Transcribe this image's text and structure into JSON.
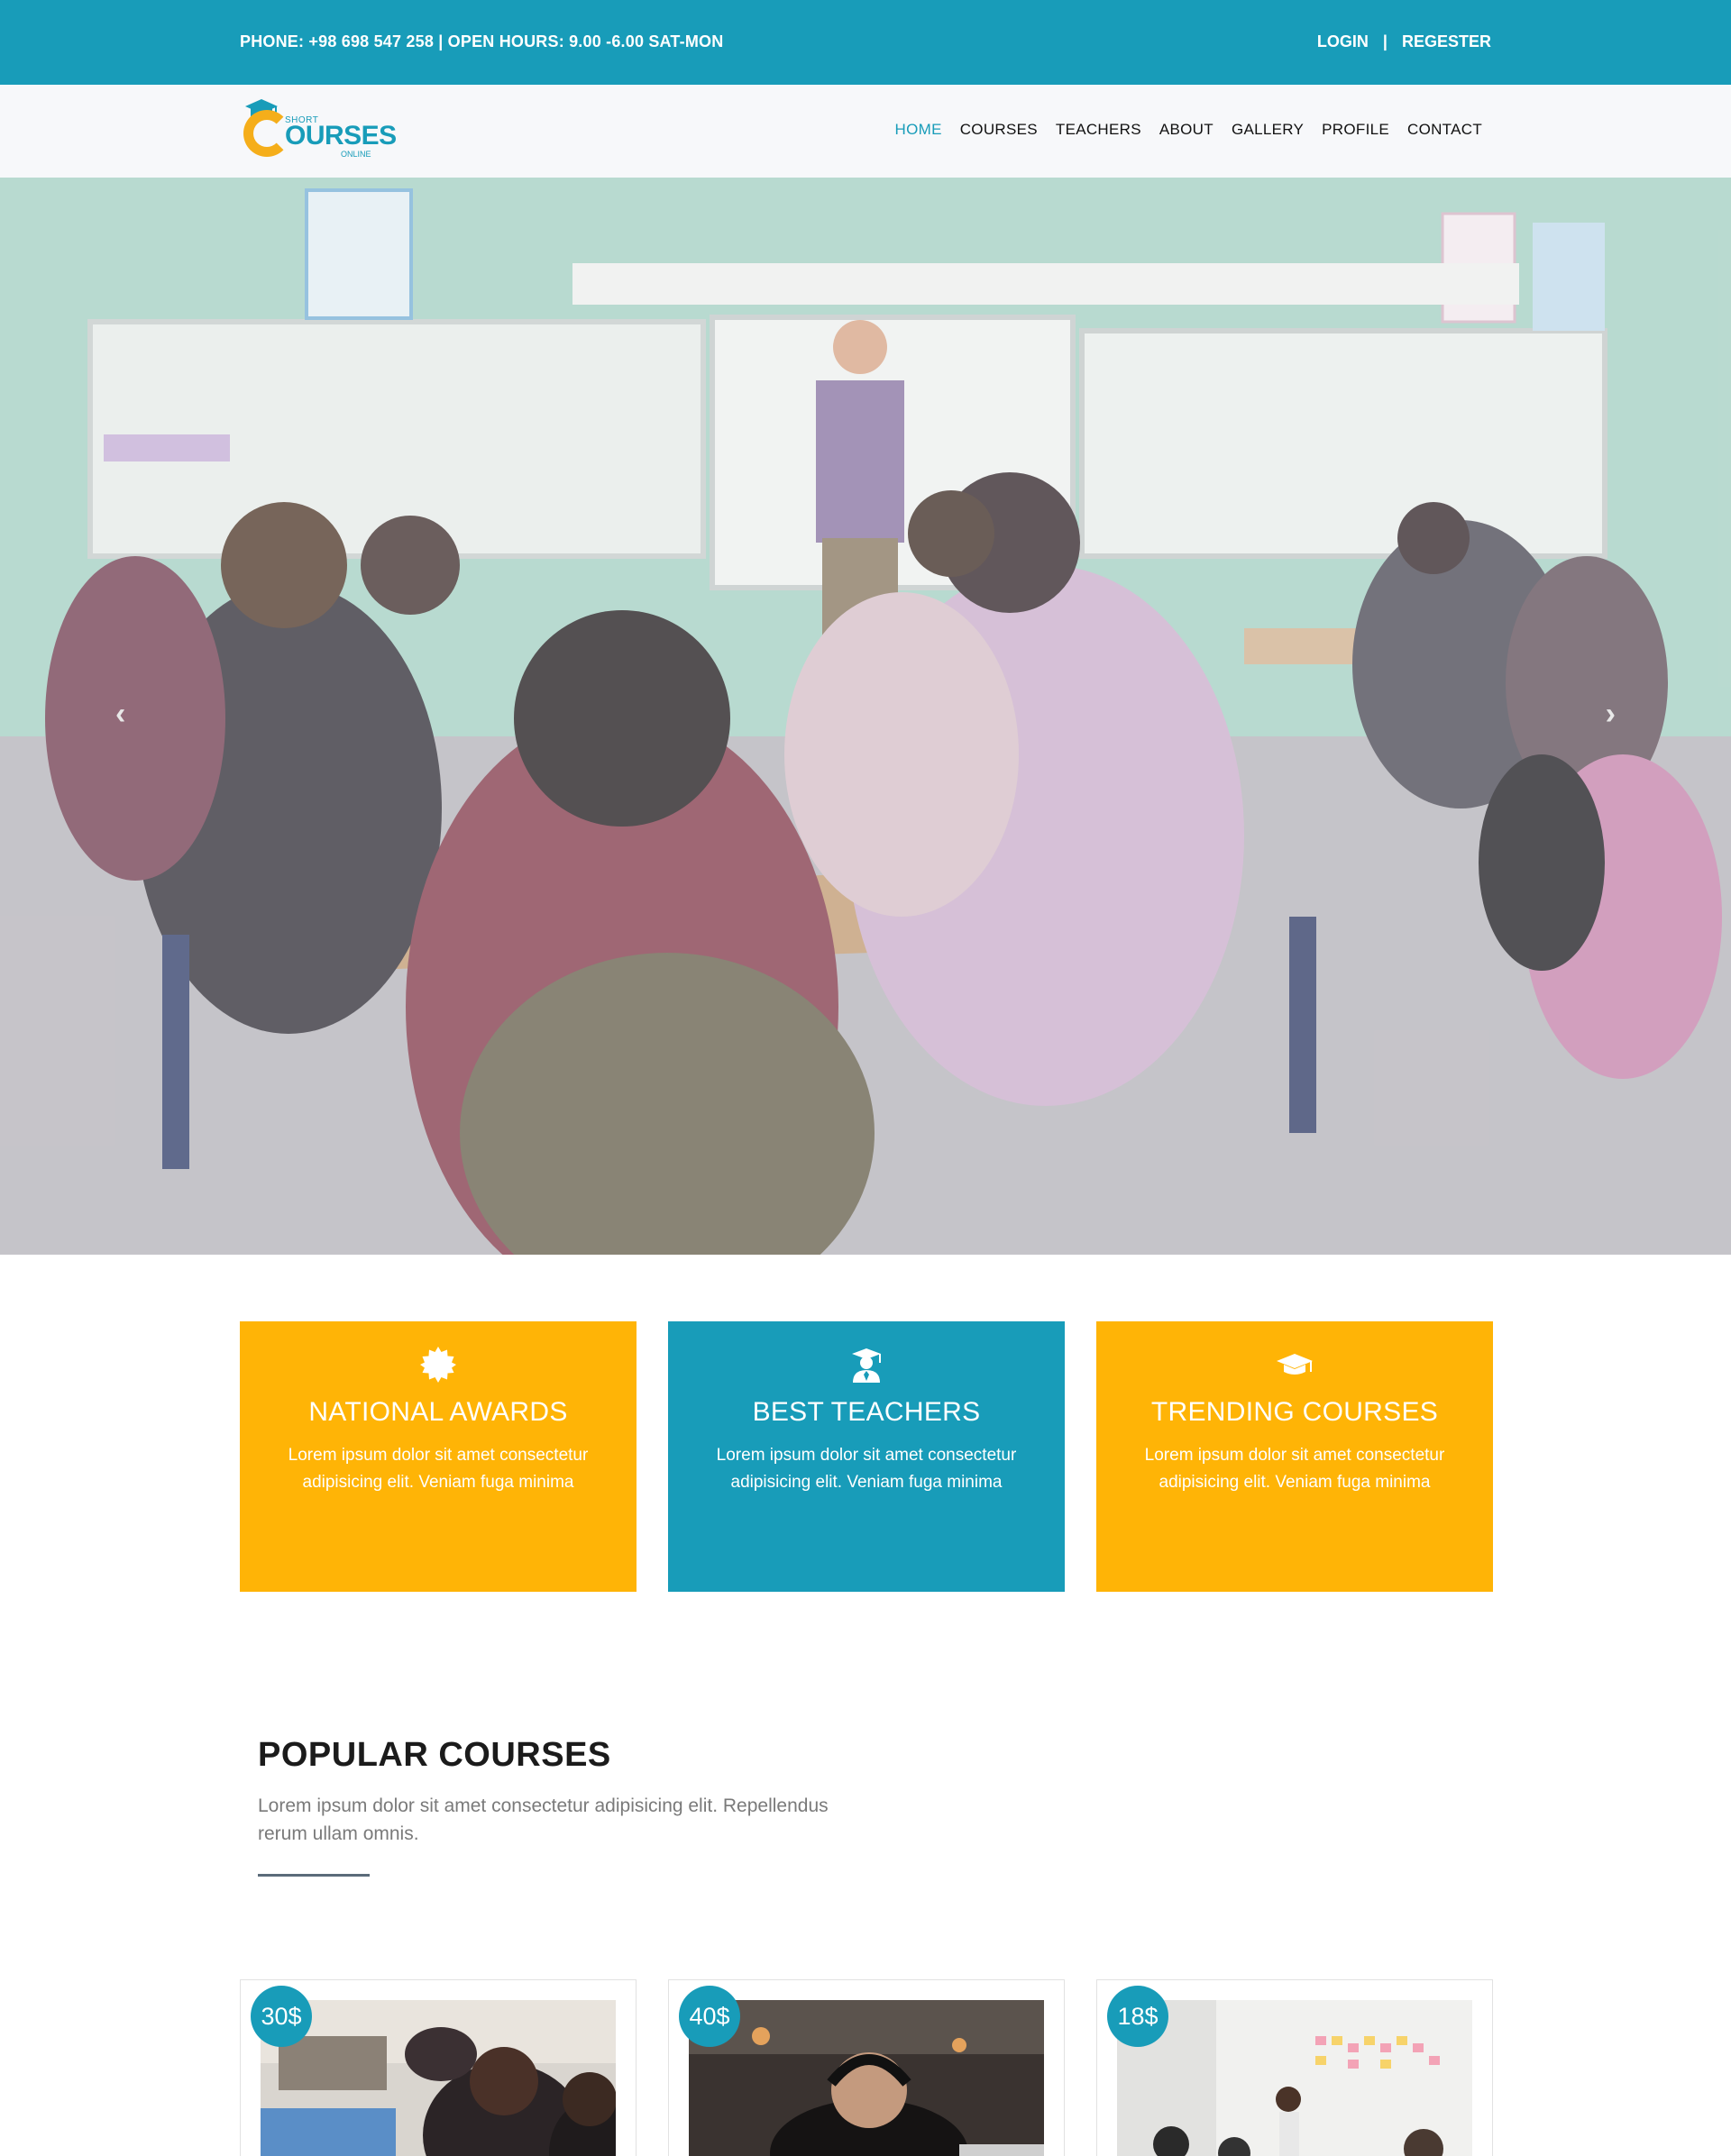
{
  "topbar": {
    "contact": "PHONE: +98 698 547 258 | OPEN HOURS: 9.00 -6.00 SAT-MON",
    "login": "LOGIN",
    "separator": "|",
    "register": "REGESTER"
  },
  "brand": {
    "short": "SHORT",
    "courses": "OURSES",
    "online": "ONLINE",
    "accent": "#189cb9",
    "secondary": "#f5ae1a"
  },
  "nav": {
    "items": [
      {
        "label": "HOME",
        "active": true
      },
      {
        "label": "COURSES"
      },
      {
        "label": "TEACHERS"
      },
      {
        "label": "ABOUT"
      },
      {
        "label": "GALLERY"
      },
      {
        "label": "PROFILE"
      },
      {
        "label": "CONTACT"
      }
    ]
  },
  "hero": {
    "prev_icon": "chevron-left-icon",
    "next_icon": "chevron-right-icon",
    "prev_glyph": "‹",
    "next_glyph": "›"
  },
  "features": [
    {
      "icon": "award-badge-icon",
      "title": "NATIONAL AWARDS",
      "text": "Lorem ipsum dolor sit amet consectetur adipisicing elit. Veniam fuga minima",
      "color": "#ffb406"
    },
    {
      "icon": "teacher-icon",
      "title": "BEST TEACHERS",
      "text": "Lorem ipsum dolor sit amet consectetur adipisicing elit. Veniam fuga minima",
      "color": "#189cb9"
    },
    {
      "icon": "graduation-cap-icon",
      "title": "TRENDING COURSES",
      "text": "Lorem ipsum dolor sit amet consectetur adipisicing elit. Veniam fuga minima",
      "color": "#ffb406"
    }
  ],
  "popular": {
    "title": "POPULAR COURSES",
    "text": "Lorem ipsum dolor sit amet consectetur adipisicing elit. Repellendus rerum ullam omnis."
  },
  "courses": [
    {
      "price": "30$"
    },
    {
      "price": "40$"
    },
    {
      "price": "18$"
    }
  ]
}
